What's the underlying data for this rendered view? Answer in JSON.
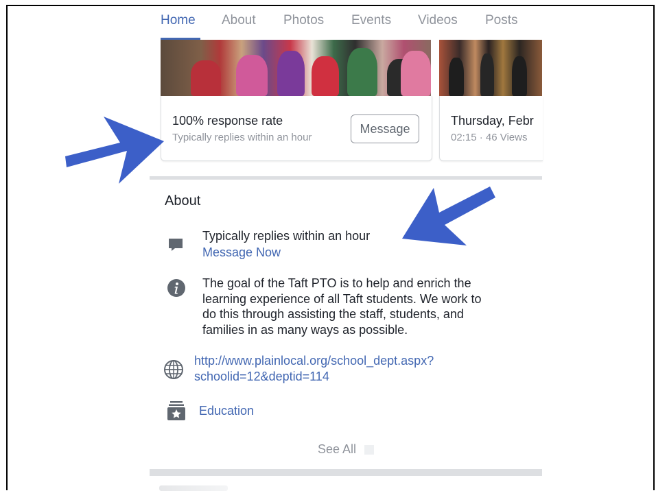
{
  "tabs": [
    "Home",
    "About",
    "Photos",
    "Events",
    "Videos",
    "Posts"
  ],
  "active_tab": "Home",
  "response_card": {
    "title": "100% response rate",
    "subtitle": "Typically replies within an hour",
    "button": "Message"
  },
  "video_card": {
    "title": "Thursday, Febr",
    "meta": "02:15 · 46 Views"
  },
  "about": {
    "title": "About",
    "response": {
      "icon": "message-bubble-icon",
      "text": "Typically replies within an hour",
      "link": "Message Now"
    },
    "description": {
      "icon": "info-icon",
      "lines": [
        "The goal of the Taft PTO is to help and enrich the",
        "learning experience of all Taft students.  We work to",
        "do this through assisting the staff, students, and",
        "families in as many ways as possible."
      ]
    },
    "website": {
      "icon": "globe-icon",
      "lines": [
        "http://www.plainlocal.org/school_dept.aspx?",
        "schoolid=12&deptid=114"
      ]
    },
    "category": {
      "icon": "category-star-icon",
      "text": "Education"
    },
    "see_all": "See All"
  },
  "annotations": {
    "arrow_color": "#3c5fc8",
    "arrow_icon": "annotation-arrow-icon"
  },
  "colors": {
    "accent": "#4267b2",
    "text": "#1d2129",
    "muted": "#90949c",
    "divider": "#dddfe2"
  }
}
